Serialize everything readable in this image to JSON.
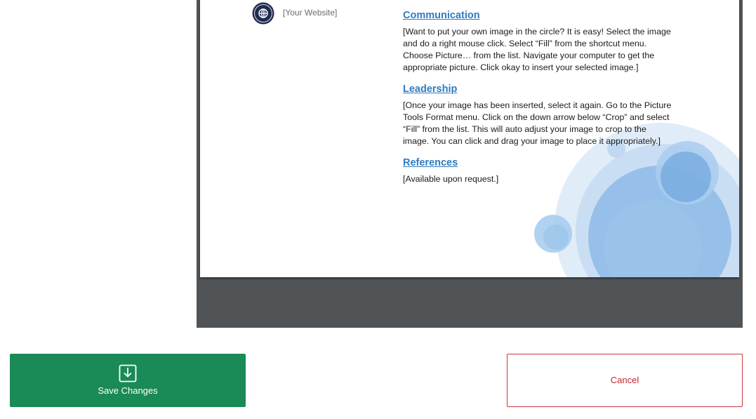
{
  "document": {
    "website_placeholder": "[Your Website]",
    "website_icon": "globe-icon",
    "sections": [
      {
        "heading": "Communication",
        "body": "[Want to put your own image in the circle?  It is easy!  Select the image\nand do a right mouse click.  Select “Fill” from the shortcut menu.\nChoose Picture… from the list.  Navigate your computer to get the\nappropriate picture.  Click okay to insert your selected image.]"
      },
      {
        "heading": "Leadership",
        "body": "[Once your image has been inserted, select it again.  Go to the Picture\nTools Format menu. Click on the down arrow below “Crop” and select\n“Fill” from the list.  This will auto adjust your image to crop to the\nimage.  You can click and drag your image to place it appropriately.]"
      },
      {
        "heading": "References",
        "body": "[Available upon request.]"
      }
    ]
  },
  "actions": {
    "save_label": "Save Changes",
    "save_icon": "save-download-icon",
    "cancel_label": "Cancel"
  },
  "colors": {
    "viewer_background": "#515456",
    "heading_accent": "#2e7bbf",
    "save_button": "#1a8a56",
    "cancel_border": "#d13438"
  }
}
